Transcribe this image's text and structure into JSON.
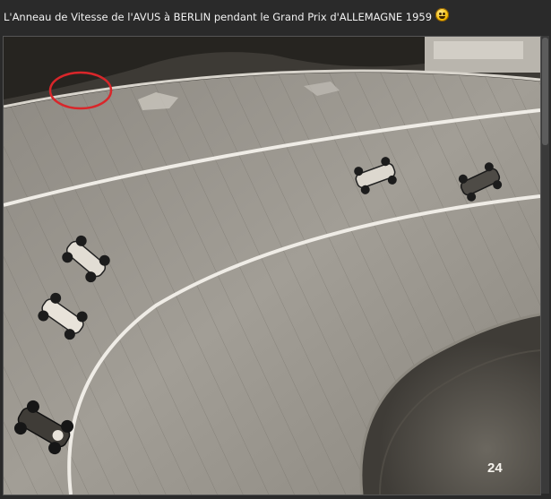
{
  "post": {
    "caption": "L'Anneau de Vitesse de l'AVUS à BERLIN pendant le Grand Prix d'ALLEMAGNE 1959",
    "emoji_icon": "laughing-smiley-icon"
  },
  "photo": {
    "page_number": "24",
    "icons": [
      "race-car-icon",
      "annotation-circle-icon"
    ]
  }
}
